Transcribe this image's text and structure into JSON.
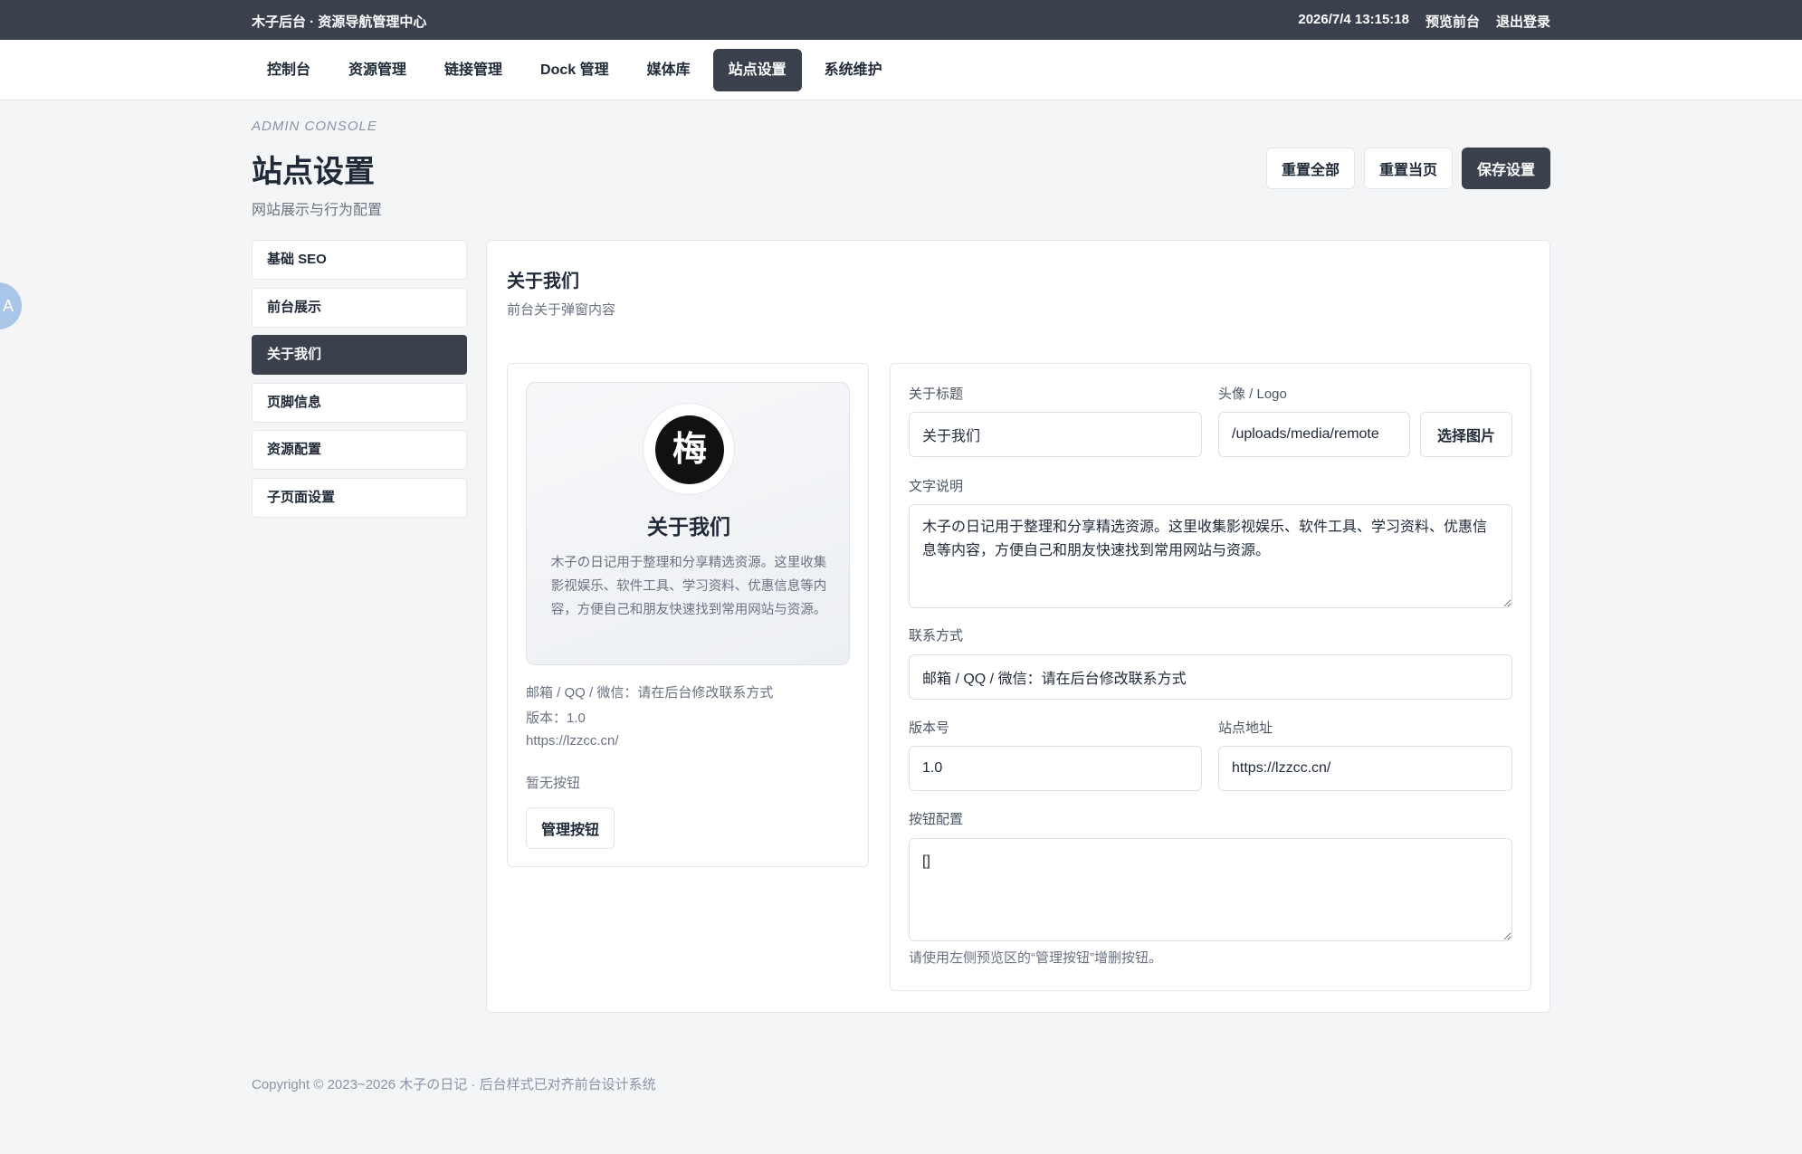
{
  "topbar": {
    "brand": "木子后台 · 资源导航管理中心",
    "datetime": "2026/7/4 13:15:18",
    "preview_link": "预览前台",
    "logout_link": "退出登录"
  },
  "nav": {
    "tabs": [
      {
        "label": "控制台"
      },
      {
        "label": "资源管理"
      },
      {
        "label": "链接管理"
      },
      {
        "label": "Dock 管理"
      },
      {
        "label": "媒体库"
      },
      {
        "label": "站点设置"
      },
      {
        "label": "系统维护"
      }
    ],
    "active": "站点设置"
  },
  "floating_button": {
    "label": "A"
  },
  "header": {
    "eyebrow": "ADMIN CONSOLE",
    "title": "站点设置",
    "subtitle": "网站展示与行为配置"
  },
  "actions": {
    "reset_all": "重置全部",
    "reset_page": "重置当页",
    "save": "保存设置"
  },
  "sidebar": {
    "items": [
      {
        "label": "基础 SEO"
      },
      {
        "label": "前台展示"
      },
      {
        "label": "关于我们"
      },
      {
        "label": "页脚信息"
      },
      {
        "label": "资源配置"
      },
      {
        "label": "子页面设置"
      }
    ],
    "active": "关于我们"
  },
  "panel": {
    "title": "关于我们",
    "subtitle": "前台关于弹窗内容"
  },
  "preview": {
    "logo_text": "梅",
    "title": "关于我们",
    "description": "木子の日记用于整理和分享精选资源。这里收集影视娱乐、软件工具、学习资料、优惠信息等内容，方便自己和朋友快速找到常用网站与资源。",
    "contact": "邮箱 / QQ / 微信：请在后台修改联系方式",
    "version": "版本：1.0",
    "url": "https://lzzcc.cn/",
    "no_buttons": "暂无按钮",
    "manage_button": "管理按钮"
  },
  "form": {
    "about_title_label": "关于标题",
    "about_title_value": "关于我们",
    "avatar_label": "头像 / Logo",
    "avatar_value": "/uploads/media/remote",
    "pick_image": "选择图片",
    "text_label": "文字说明",
    "text_value": "木子の日记用于整理和分享精选资源。这里收集影视娱乐、软件工具、学习资料、优惠信息等内容，方便自己和朋友快速找到常用网站与资源。",
    "contact_label": "联系方式",
    "contact_value": "邮箱 / QQ / 微信：请在后台修改联系方式",
    "version_label": "版本号",
    "version_value": "1.0",
    "site_label": "站点地址",
    "site_value": "https://lzzcc.cn/",
    "buttons_label": "按钮配置",
    "buttons_value": "[]",
    "hint": "请使用左侧预览区的“管理按钮”增删按钮。"
  },
  "footer": {
    "text": "Copyright © 2023~2026 木子の日记 · 后台样式已对齐前台设计系统"
  },
  "colors": {
    "dark": "#3b404d",
    "background": "#f4f5f6",
    "muted": "#6b7280"
  }
}
